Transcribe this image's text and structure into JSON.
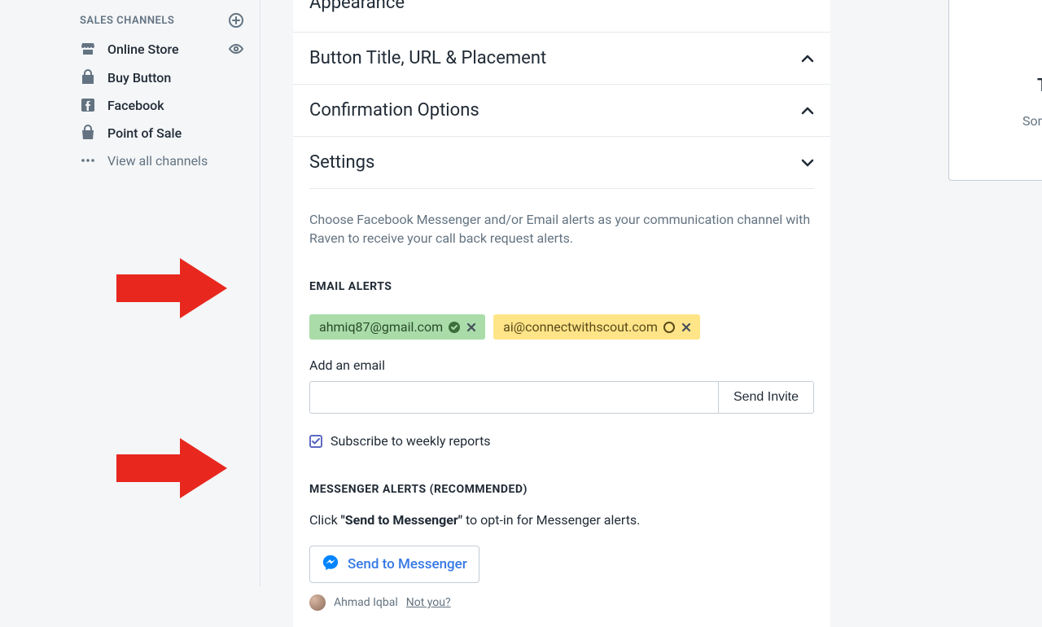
{
  "sidebar": {
    "heading": "SALES CHANNELS",
    "items": [
      {
        "label": "Online Store"
      },
      {
        "label": "Buy Button"
      },
      {
        "label": "Facebook"
      },
      {
        "label": "Point of Sale"
      }
    ],
    "view_all": "View all channels"
  },
  "accordion": {
    "appearance": "Appearance",
    "button_title": "Button Title, URL & Placement",
    "confirmation": "Confirmation Options",
    "settings": "Settings"
  },
  "settings": {
    "description": "Choose Facebook Messenger and/or Email alerts as your communication channel with Raven to receive your call back request alerts.",
    "email_heading": "EMAIL ALERTS",
    "chips": [
      {
        "email": "ahmiq87@gmail.com",
        "status": "verified"
      },
      {
        "email": "ai@connectwithscout.com",
        "status": "pending"
      }
    ],
    "add_email_label": "Add an email",
    "send_invite": "Send Invite",
    "subscribe_label": "Subscribe to weekly reports",
    "messenger_heading": "MESSENGER ALERTS (RECOMMENDED)",
    "messenger_instr_pre": "Click ",
    "messenger_instr_bold": "\"Send to Messenger\"",
    "messenger_instr_post": " to opt-in for Messenger alerts.",
    "send_to_messenger": "Send to Messenger",
    "user_name": "Ahmad Iqbal",
    "not_you": "Not you?"
  },
  "peek": {
    "title": "T",
    "sub": "Som"
  }
}
